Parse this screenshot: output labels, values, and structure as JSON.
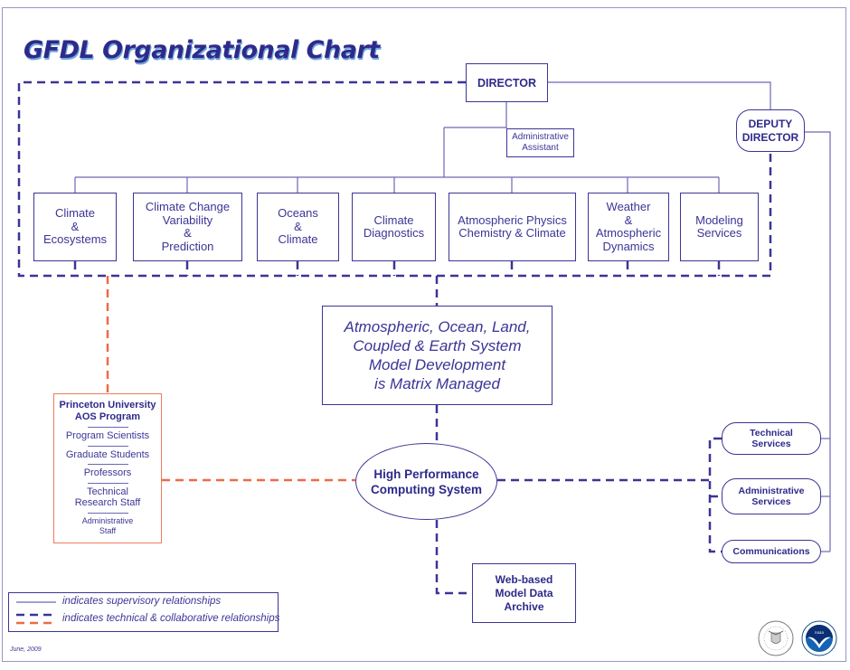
{
  "title": "GFDL Organizational Chart",
  "director": {
    "label": "DIRECTOR"
  },
  "admin_assistant": {
    "label": "Administrative\nAssistant"
  },
  "deputy_director": {
    "label": "DEPUTY\nDIRECTOR"
  },
  "divisions": [
    {
      "label": "Climate\n&\nEcosystems"
    },
    {
      "label": "Climate Change\nVariability\n&\nPrediction"
    },
    {
      "label": "Oceans\n&\nClimate"
    },
    {
      "label": "Climate\nDiagnostics"
    },
    {
      "label": "Atmospheric Physics\nChemistry & Climate"
    },
    {
      "label": "Weather\n&\nAtmospheric\nDynamics"
    },
    {
      "label": "Modeling\nServices"
    }
  ],
  "matrix_box": {
    "label": "Atmospheric, Ocean, Land,\nCoupled & Earth System\nModel Development\nis Matrix Managed"
  },
  "hpc": {
    "label": "High Performance\nComputing System"
  },
  "archive": {
    "label": "Web-based\nModel Data\nArchive"
  },
  "services": [
    {
      "label": "Technical\nServices"
    },
    {
      "label": "Administrative\nServices"
    },
    {
      "label": "Communications"
    }
  ],
  "princeton": {
    "heading": "Princeton University\nAOS Program",
    "items": [
      "Program Scientists",
      "Graduate Students",
      "Professors",
      "Technical\nResearch Staff",
      "Administrative\nStaff"
    ]
  },
  "legend": {
    "supervisory": "indicates supervisory relationships",
    "technical": "indicates technical & collaborative relationships"
  },
  "date": "June, 2009",
  "logos": {
    "left": "department-of-commerce-seal",
    "right": "noaa-logo"
  },
  "colors": {
    "primary": "#2e2a8a",
    "supervisory_line": "#6d68b4",
    "technical_line": "#3b3596",
    "collaborative_line": "#ef6a47",
    "frame": "#9a95c8"
  }
}
